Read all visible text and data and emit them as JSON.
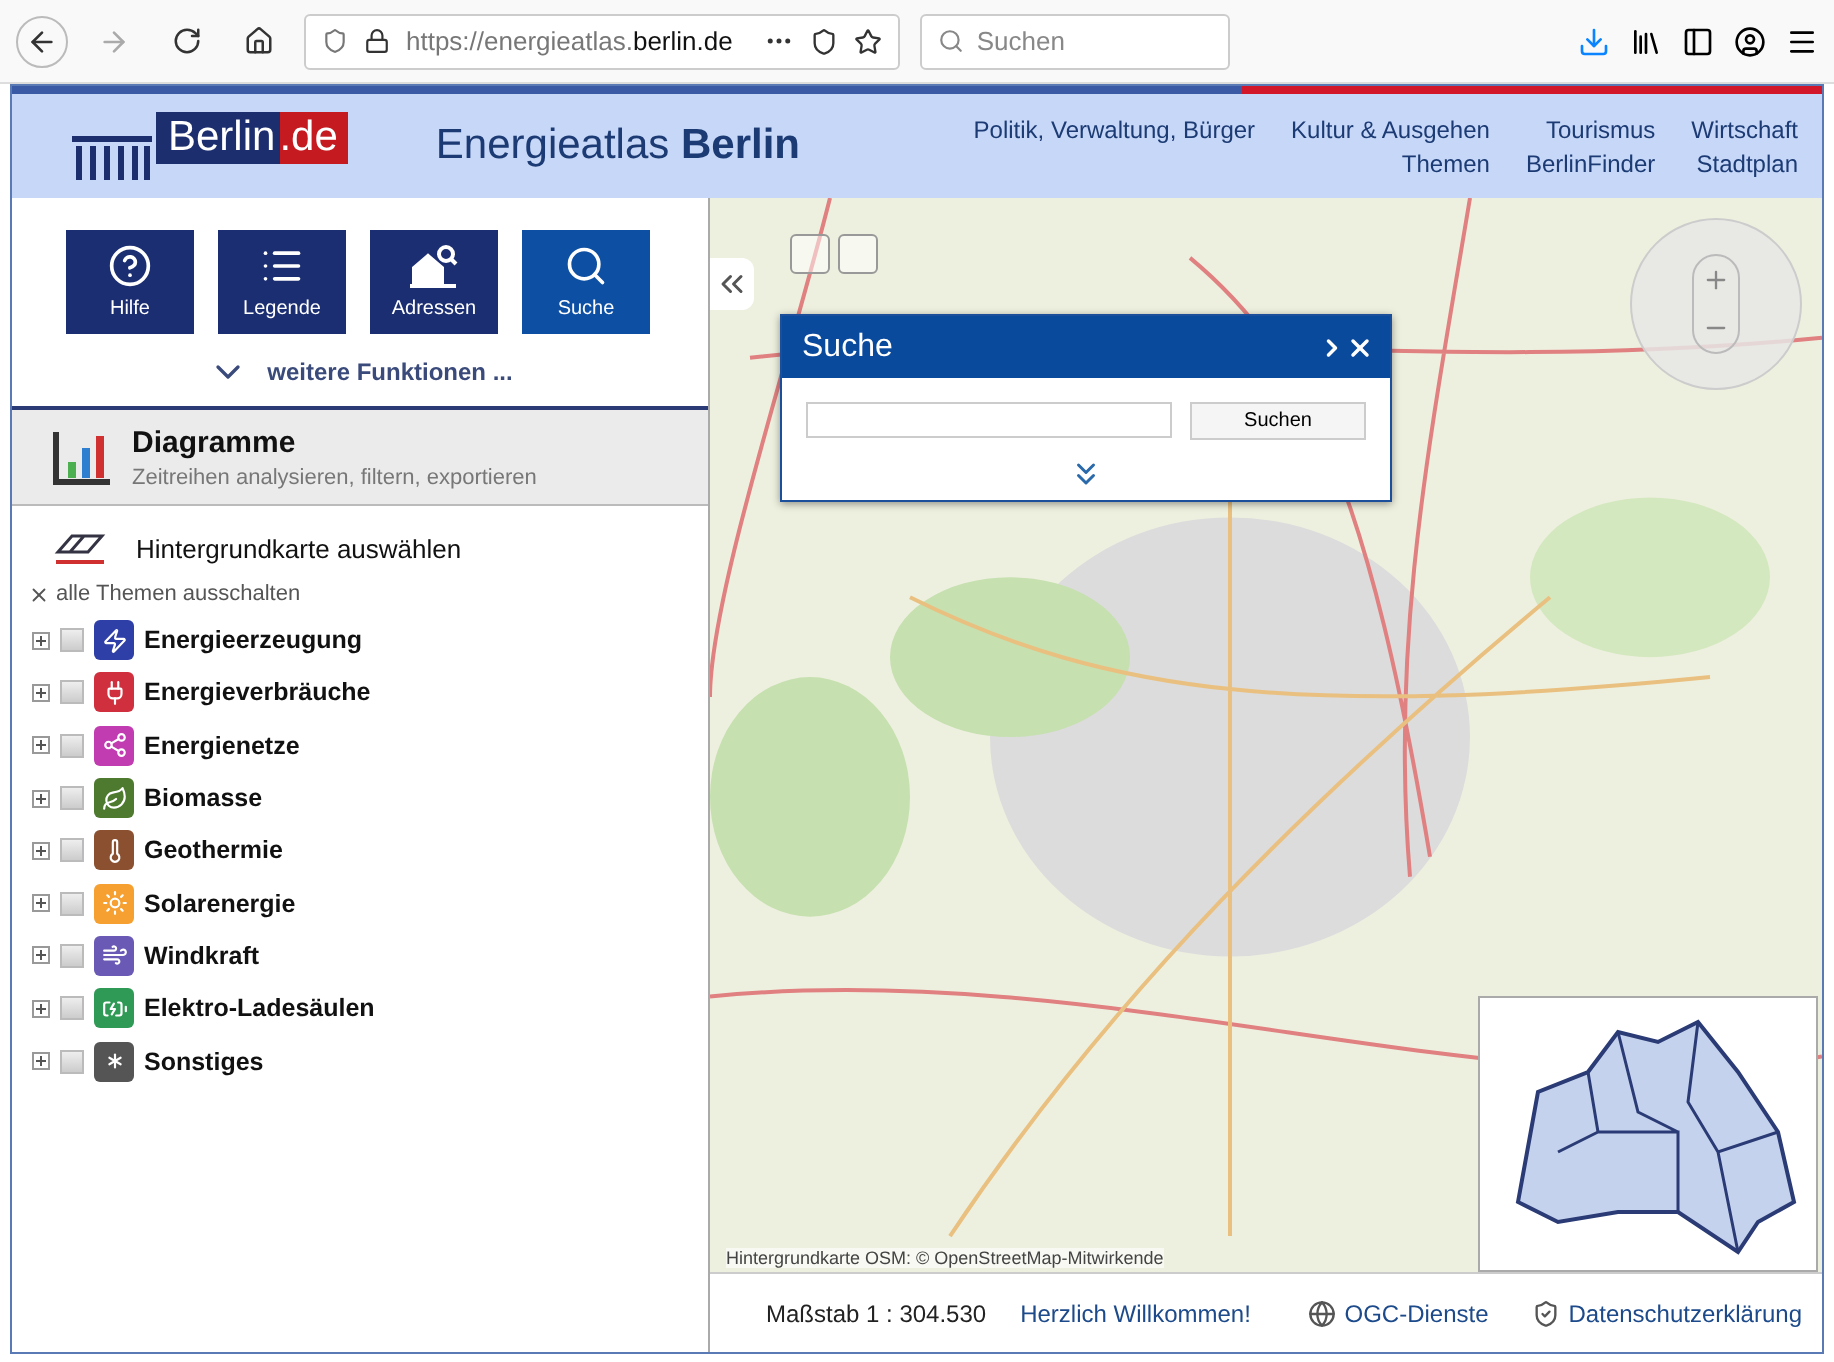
{
  "browser": {
    "url": "https://energieatlas.**berlin.de**",
    "search_placeholder": "Suchen"
  },
  "header": {
    "logo_text": "Berlin",
    "logo_suffix": ".de",
    "title": "Energieatlas **Berlin**",
    "nav_top": [
      "Politik, Verwaltung, Bürger",
      "Kultur & Ausgehen",
      "Tourismus",
      "Wirtschaft"
    ],
    "nav_bottom": [
      "Themen",
      "BerlinFinder",
      "Stadtplan"
    ]
  },
  "sidebar": {
    "tools": [
      {
        "label": "Hilfe",
        "kind": "help",
        "selected": false
      },
      {
        "label": "Legende",
        "kind": "list",
        "selected": false
      },
      {
        "label": "Adressen",
        "kind": "address",
        "selected": false
      },
      {
        "label": "Suche",
        "kind": "search",
        "selected": true
      }
    ],
    "more": "weitere Funktionen ...",
    "diagram": {
      "title": "Diagramme",
      "subtitle": "Zeitreihen analysieren, filtern, exportieren"
    },
    "basemap": "Hintergrundkarte auswählen",
    "themes_off": "alle Themen ausschalten",
    "themes": [
      {
        "label": "Energieerzeugung",
        "kind": "bolt",
        "color": "#2f3fa8",
        "checked": false
      },
      {
        "label": "Energieverbräuche",
        "kind": "plug",
        "color": "#d0303e",
        "checked": false
      },
      {
        "label": "Energienetze",
        "kind": "network",
        "color": "#c03cb0",
        "checked": false
      },
      {
        "label": "Biomasse",
        "kind": "leaf",
        "color": "#4d7a2e",
        "checked": false
      },
      {
        "label": "Geothermie",
        "kind": "heat",
        "color": "#8a5030",
        "checked": false
      },
      {
        "label": "Solarenergie",
        "kind": "sun",
        "color": "#f5a030",
        "checked": false
      },
      {
        "label": "Windkraft",
        "kind": "wind",
        "color": "#6a5ab5",
        "checked": false
      },
      {
        "label": "Elektro-Ladesäulen",
        "kind": "charger",
        "color": "#2f9a55",
        "checked": false
      },
      {
        "label": "Sonstiges",
        "kind": "other",
        "color": "#555555",
        "checked": false
      }
    ]
  },
  "search_panel": {
    "title": "Suche",
    "button": "Suchen"
  },
  "map": {
    "attribution": "Hintergrundkarte OSM: © OpenStreetMap-Mitwirkende"
  },
  "footer": {
    "scale": "Maßstab 1 : 304.530",
    "welcome": "Herzlich Willkommen!",
    "links": [
      {
        "label": "OGC-Dienste",
        "kind": "globe"
      },
      {
        "label": "Datenschutzerklärung",
        "kind": "shield"
      }
    ]
  }
}
